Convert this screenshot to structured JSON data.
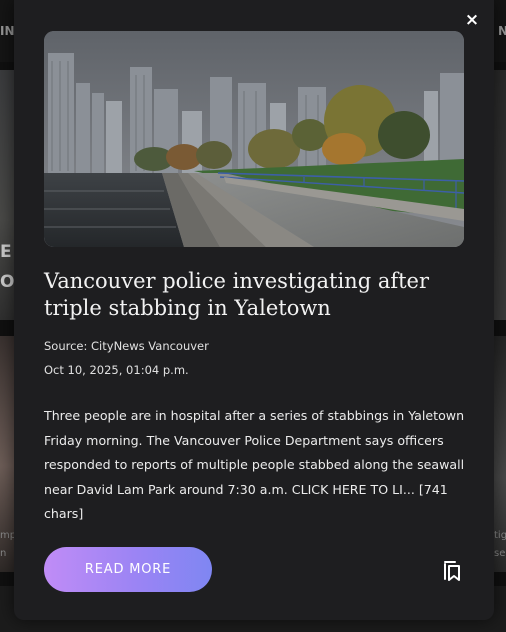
{
  "background_page": {
    "nav_left_text": "IN",
    "nav_right_text": "N",
    "fragment_left_1": "E",
    "fragment_left_2": "O",
    "fragment_small_left_1": "mp",
    "fragment_small_left_2": "n",
    "fragment_small_right_1": "tig",
    "fragment_small_right_2": "se"
  },
  "modal": {
    "close_label": "×",
    "headline": "Vancouver police investigating after triple stabbing in Yaletown",
    "source": "Source: CityNews Vancouver",
    "date": "Oct 10, 2025, 01:04 p.m.",
    "summary": "Three people are in hospital after a series of stabbings in Yaletown Friday morning. The Vancouver Police Department says officers responded to reports of multiple people stabbed along the seawall near David Lam Park around 7:30 a.m. CLICK HERE TO LI... [741 chars]",
    "read_more_label": "READ MORE",
    "bookmark_icon": "bookmark-stack-icon"
  },
  "colors": {
    "modal_bg": "#1e1e20",
    "button_gradient_start": "#c08cf6",
    "button_gradient_end": "#7f86f2",
    "text": "#ececec"
  }
}
